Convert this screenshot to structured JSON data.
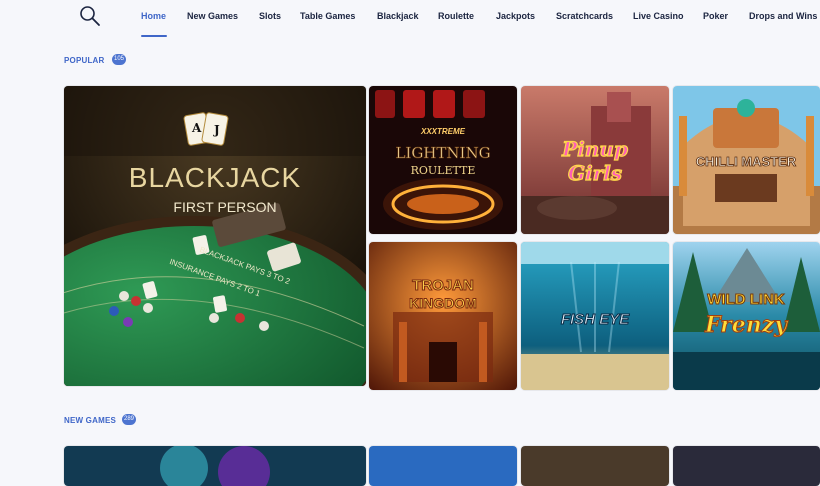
{
  "nav": {
    "items": [
      {
        "label": "Home",
        "active": true
      },
      {
        "label": "New Games"
      },
      {
        "label": "Slots"
      },
      {
        "label": "Table Games"
      },
      {
        "label": "Blackjack"
      },
      {
        "label": "Roulette"
      },
      {
        "label": "Jackpots"
      },
      {
        "label": "Scratchcards"
      },
      {
        "label": "Live Casino"
      },
      {
        "label": "Poker"
      },
      {
        "label": "Drops and Wins"
      }
    ],
    "search_icon": "search-icon",
    "accent_color": "#3f66c8"
  },
  "sections": {
    "popular": {
      "title": "POPULAR",
      "count": "105"
    },
    "new_games": {
      "title": "NEW GAMES",
      "count": "289"
    }
  },
  "games": {
    "blackjack": {
      "title_line1": "BLACKJACK",
      "title_line2": "FIRST PERSON",
      "table_text1": "BLACKJACK PAYS 3 TO 2",
      "table_text2": "INSURANCE PAYS 2 TO 1"
    },
    "lightning": {
      "title_line1": "XXXTREME",
      "title_line2": "LIGHTNING",
      "title_line3": "ROULETTE"
    },
    "pinup": {
      "title_line1": "Pinup",
      "title_line2": "Girls"
    },
    "chilli": {
      "title": "CHILLI MASTER"
    },
    "trojan": {
      "title_line1": "TROJAN",
      "title_line2": "KINGDOM"
    },
    "fisheye": {
      "title": "FISH EYE"
    },
    "wildlink": {
      "title_line1": "WILD LINK",
      "title_line2": "Frenzy"
    }
  }
}
